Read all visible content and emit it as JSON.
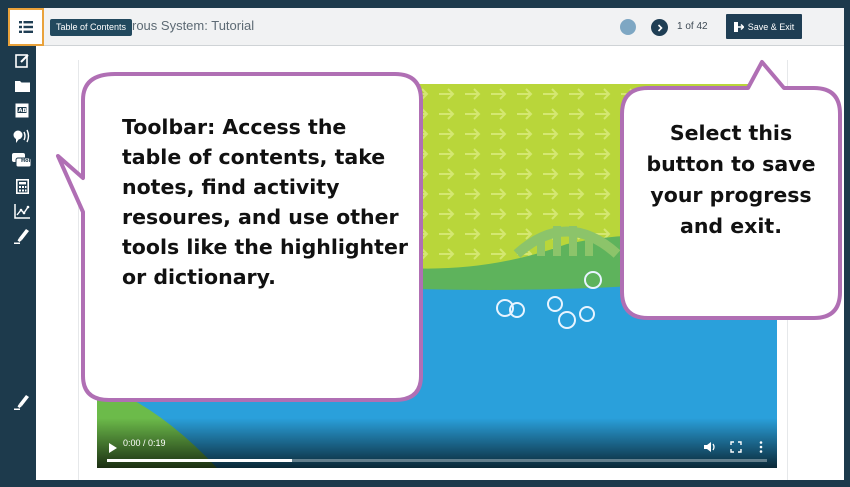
{
  "header": {
    "tooltip": "Table of Contents",
    "title": "rous System: Tutorial",
    "page_indicator": "1  of 42",
    "save_exit_label": "Save & Exit"
  },
  "toolbar": {
    "icons": [
      "list-icon",
      "notes-icon",
      "folder-icon",
      "glossary-icon",
      "read-aloud-icon",
      "translate-icon",
      "calculator-icon",
      "graph-icon",
      "highlighter-icon",
      "eraser-icon"
    ],
    "translate_badge": "Hola"
  },
  "video": {
    "time": "0:00 / 0:19",
    "progress": 0.28,
    "colors": {
      "sky": "#b9d63a",
      "water": "#2aa0db",
      "hill": "#5eb35c"
    }
  },
  "callouts": {
    "toolbar": "Toolbar: Access the table of contents, take notes, find activity resoures, and use other tools like the highlighter or dictionary.",
    "save": "Select this button to save your progress and exit."
  },
  "colors": {
    "frame": "#1d3a4c",
    "accent": "#e9a23b",
    "callout_border": "#b06fb4"
  }
}
